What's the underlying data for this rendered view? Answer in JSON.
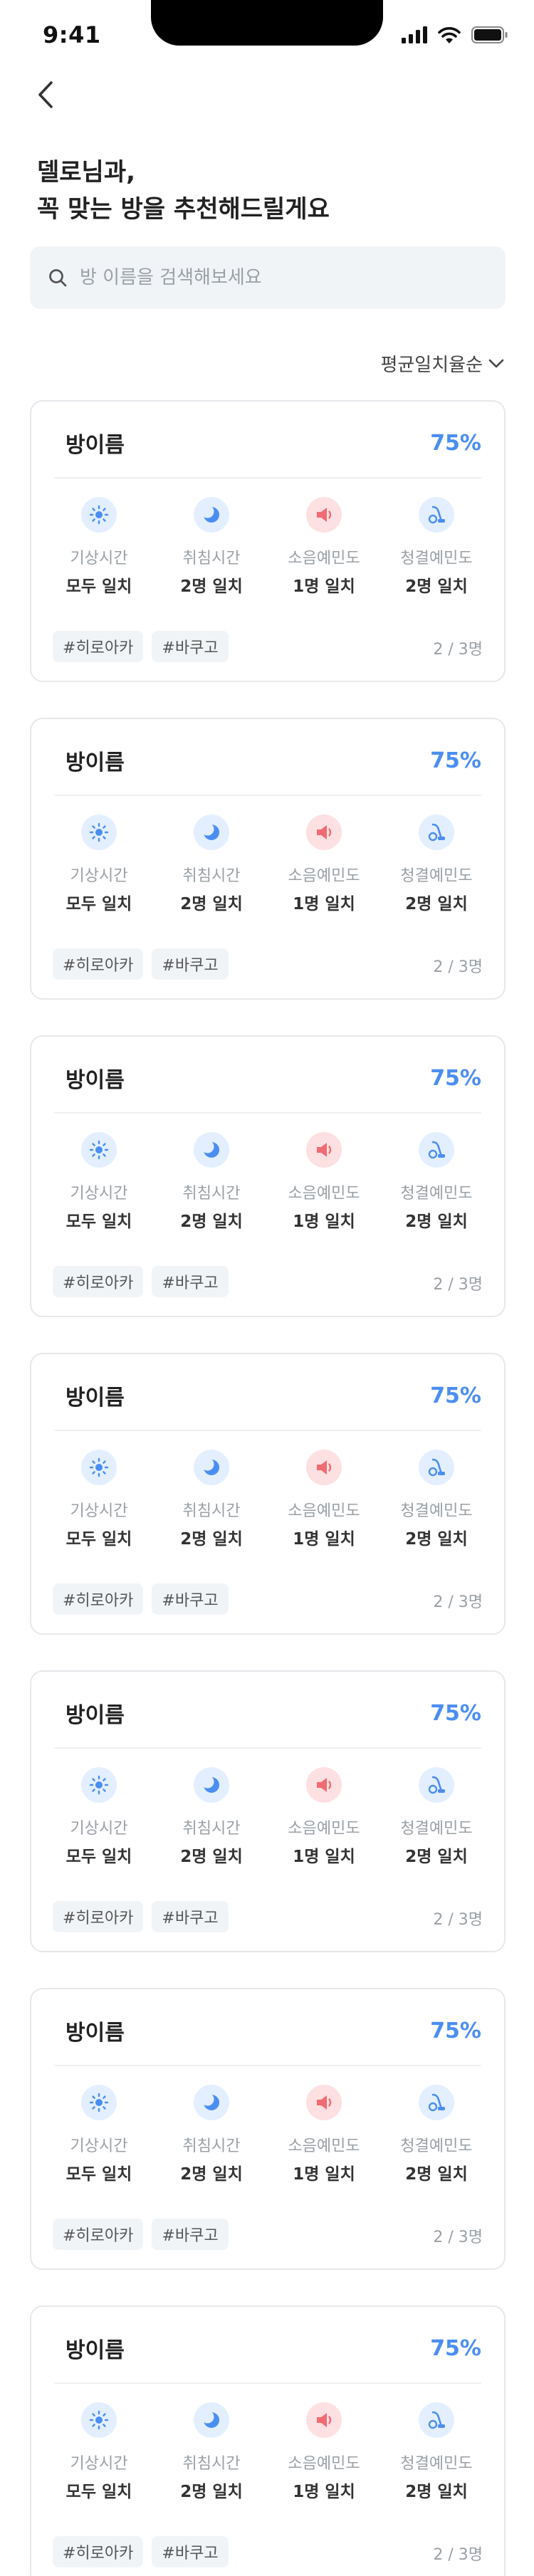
{
  "status_bar": {
    "time": "9:41"
  },
  "header": {
    "line1": "델로님과,",
    "line2": "꼭 맞는 방을 추천해드릴게요"
  },
  "search": {
    "placeholder": "방 이름을 검색해보세요",
    "value": ""
  },
  "sort": {
    "label": "평균일치율순"
  },
  "colors": {
    "accent": "#4b8ef1",
    "alert": "#f06b73"
  },
  "rooms": [
    {
      "title": "방이름",
      "match": "75%",
      "metrics": [
        {
          "icon": "sun-icon",
          "label": "기상시간",
          "value": "모두 일치"
        },
        {
          "icon": "moon-icon",
          "label": "취침시간",
          "value": "2명 일치"
        },
        {
          "icon": "speaker-icon",
          "label": "소음예민도",
          "value": "1명 일치"
        },
        {
          "icon": "vacuum-icon",
          "label": "청결예민도",
          "value": "2명 일치"
        }
      ],
      "tags": [
        "#히로아카",
        "#바쿠고"
      ],
      "count": "2 / 3명"
    },
    {
      "title": "방이름",
      "match": "75%",
      "metrics": [
        {
          "icon": "sun-icon",
          "label": "기상시간",
          "value": "모두 일치"
        },
        {
          "icon": "moon-icon",
          "label": "취침시간",
          "value": "2명 일치"
        },
        {
          "icon": "speaker-icon",
          "label": "소음예민도",
          "value": "1명 일치"
        },
        {
          "icon": "vacuum-icon",
          "label": "청결예민도",
          "value": "2명 일치"
        }
      ],
      "tags": [
        "#히로아카",
        "#바쿠고"
      ],
      "count": "2 / 3명"
    },
    {
      "title": "방이름",
      "match": "75%",
      "metrics": [
        {
          "icon": "sun-icon",
          "label": "기상시간",
          "value": "모두 일치"
        },
        {
          "icon": "moon-icon",
          "label": "취침시간",
          "value": "2명 일치"
        },
        {
          "icon": "speaker-icon",
          "label": "소음예민도",
          "value": "1명 일치"
        },
        {
          "icon": "vacuum-icon",
          "label": "청결예민도",
          "value": "2명 일치"
        }
      ],
      "tags": [
        "#히로아카",
        "#바쿠고"
      ],
      "count": "2 / 3명"
    },
    {
      "title": "방이름",
      "match": "75%",
      "metrics": [
        {
          "icon": "sun-icon",
          "label": "기상시간",
          "value": "모두 일치"
        },
        {
          "icon": "moon-icon",
          "label": "취침시간",
          "value": "2명 일치"
        },
        {
          "icon": "speaker-icon",
          "label": "소음예민도",
          "value": "1명 일치"
        },
        {
          "icon": "vacuum-icon",
          "label": "청결예민도",
          "value": "2명 일치"
        }
      ],
      "tags": [
        "#히로아카",
        "#바쿠고"
      ],
      "count": "2 / 3명"
    },
    {
      "title": "방이름",
      "match": "75%",
      "metrics": [
        {
          "icon": "sun-icon",
          "label": "기상시간",
          "value": "모두 일치"
        },
        {
          "icon": "moon-icon",
          "label": "취침시간",
          "value": "2명 일치"
        },
        {
          "icon": "speaker-icon",
          "label": "소음예민도",
          "value": "1명 일치"
        },
        {
          "icon": "vacuum-icon",
          "label": "청결예민도",
          "value": "2명 일치"
        }
      ],
      "tags": [
        "#히로아카",
        "#바쿠고"
      ],
      "count": "2 / 3명"
    },
    {
      "title": "방이름",
      "match": "75%",
      "metrics": [
        {
          "icon": "sun-icon",
          "label": "기상시간",
          "value": "모두 일치"
        },
        {
          "icon": "moon-icon",
          "label": "취침시간",
          "value": "2명 일치"
        },
        {
          "icon": "speaker-icon",
          "label": "소음예민도",
          "value": "1명 일치"
        },
        {
          "icon": "vacuum-icon",
          "label": "청결예민도",
          "value": "2명 일치"
        }
      ],
      "tags": [
        "#히로아카",
        "#바쿠고"
      ],
      "count": "2 / 3명"
    },
    {
      "title": "방이름",
      "match": "75%",
      "metrics": [
        {
          "icon": "sun-icon",
          "label": "기상시간",
          "value": "모두 일치"
        },
        {
          "icon": "moon-icon",
          "label": "취침시간",
          "value": "2명 일치"
        },
        {
          "icon": "speaker-icon",
          "label": "소음예민도",
          "value": "1명 일치"
        },
        {
          "icon": "vacuum-icon",
          "label": "청결예민도",
          "value": "2명 일치"
        }
      ],
      "tags": [
        "#히로아카",
        "#바쿠고"
      ],
      "count": "2 / 3명"
    }
  ]
}
